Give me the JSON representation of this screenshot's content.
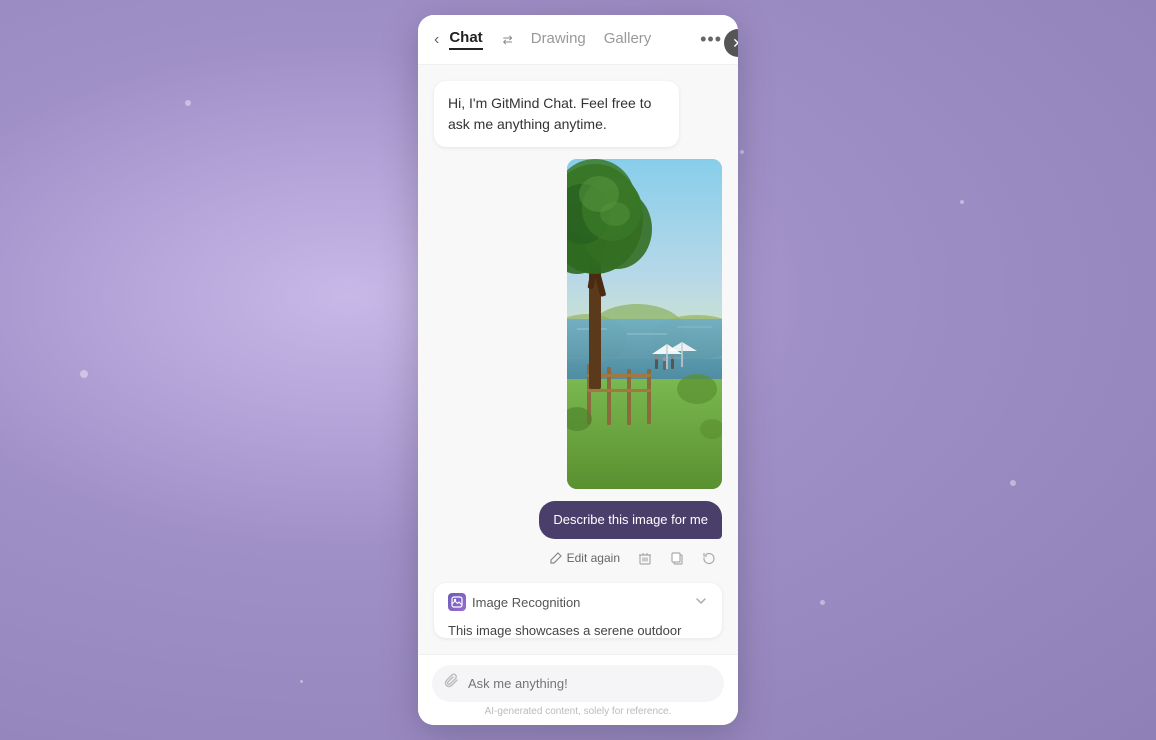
{
  "background": {
    "color": "#b0a0d0"
  },
  "close_button": {
    "symbol": "✕"
  },
  "expand_arrow": {
    "symbol": "▶"
  },
  "header": {
    "back_symbol": "‹",
    "tabs": [
      {
        "id": "chat",
        "label": "Chat",
        "active": true
      },
      {
        "id": "drawing",
        "label": "Drawing",
        "active": false
      },
      {
        "id": "gallery",
        "label": "Gallery",
        "active": false
      }
    ],
    "swap_icon": "⇄",
    "more_icon": "•••"
  },
  "welcome_message": {
    "text": "Hi, I'm GitMind Chat. Feel free to ask me anything anytime."
  },
  "user_message": {
    "text": "Describe this image for me"
  },
  "action_buttons": [
    {
      "id": "edit",
      "label": "Edit again",
      "icon": "✏️"
    },
    {
      "id": "delete",
      "icon": "🗑"
    },
    {
      "id": "copy",
      "icon": "⧉"
    },
    {
      "id": "refresh",
      "icon": "↺"
    }
  ],
  "ai_response": {
    "label": "Image Recognition",
    "icon": "🔍",
    "text": "This image showcases a serene outdoor setting"
  },
  "input": {
    "placeholder": "Ask me anything!",
    "attach_icon": "🔗"
  },
  "disclaimer": {
    "text": "AI-generated content, solely for reference."
  }
}
